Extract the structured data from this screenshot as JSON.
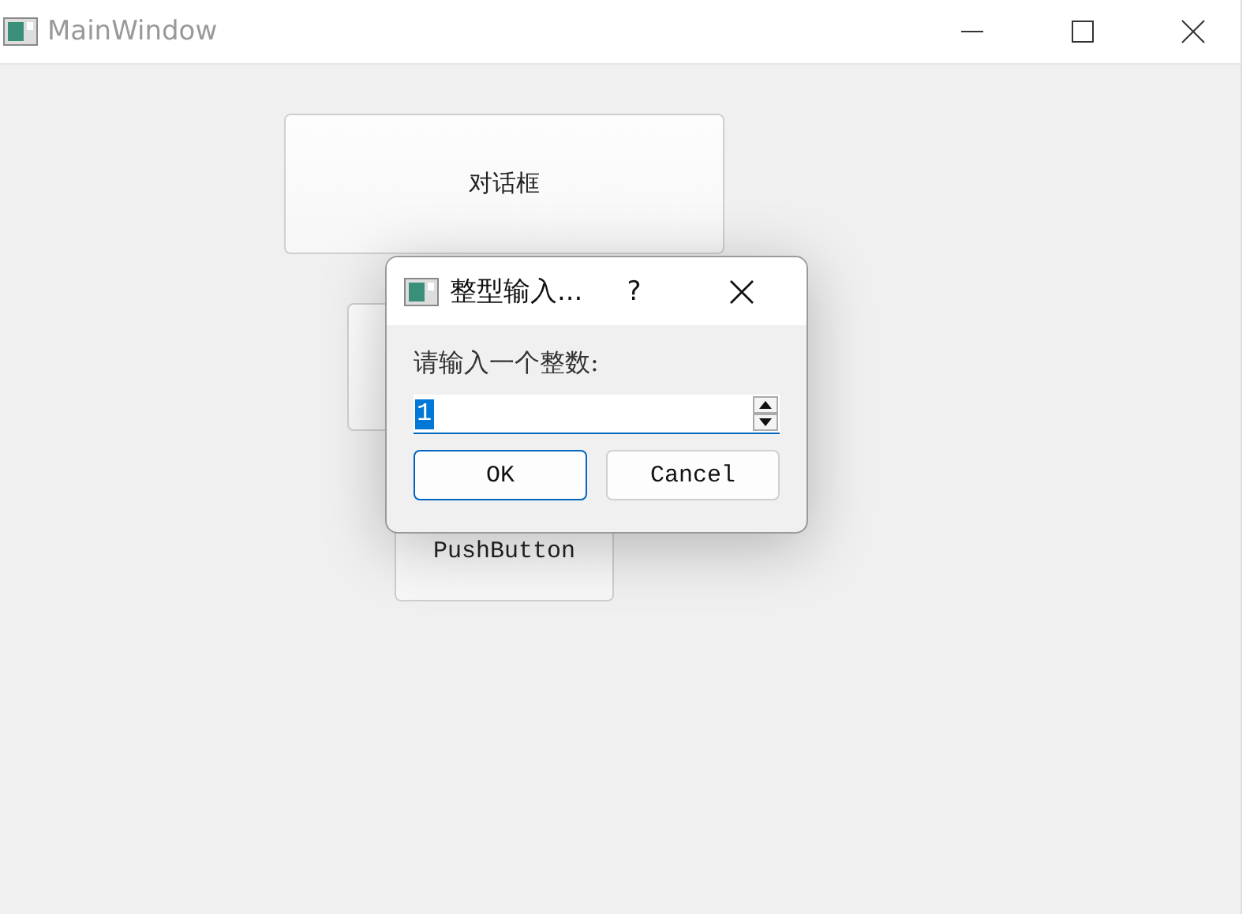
{
  "window": {
    "title": "MainWindow"
  },
  "buttons": [
    {
      "label": "对话框"
    },
    {
      "label": "PushButton"
    }
  ],
  "dialog": {
    "title": "整型输入...",
    "help": "?",
    "prompt": "请输入一个整数:",
    "spinbox": {
      "value": "1",
      "selected": true
    },
    "actions": [
      {
        "label": "OK",
        "default": true
      },
      {
        "label": "Cancel",
        "default": false
      }
    ]
  }
}
